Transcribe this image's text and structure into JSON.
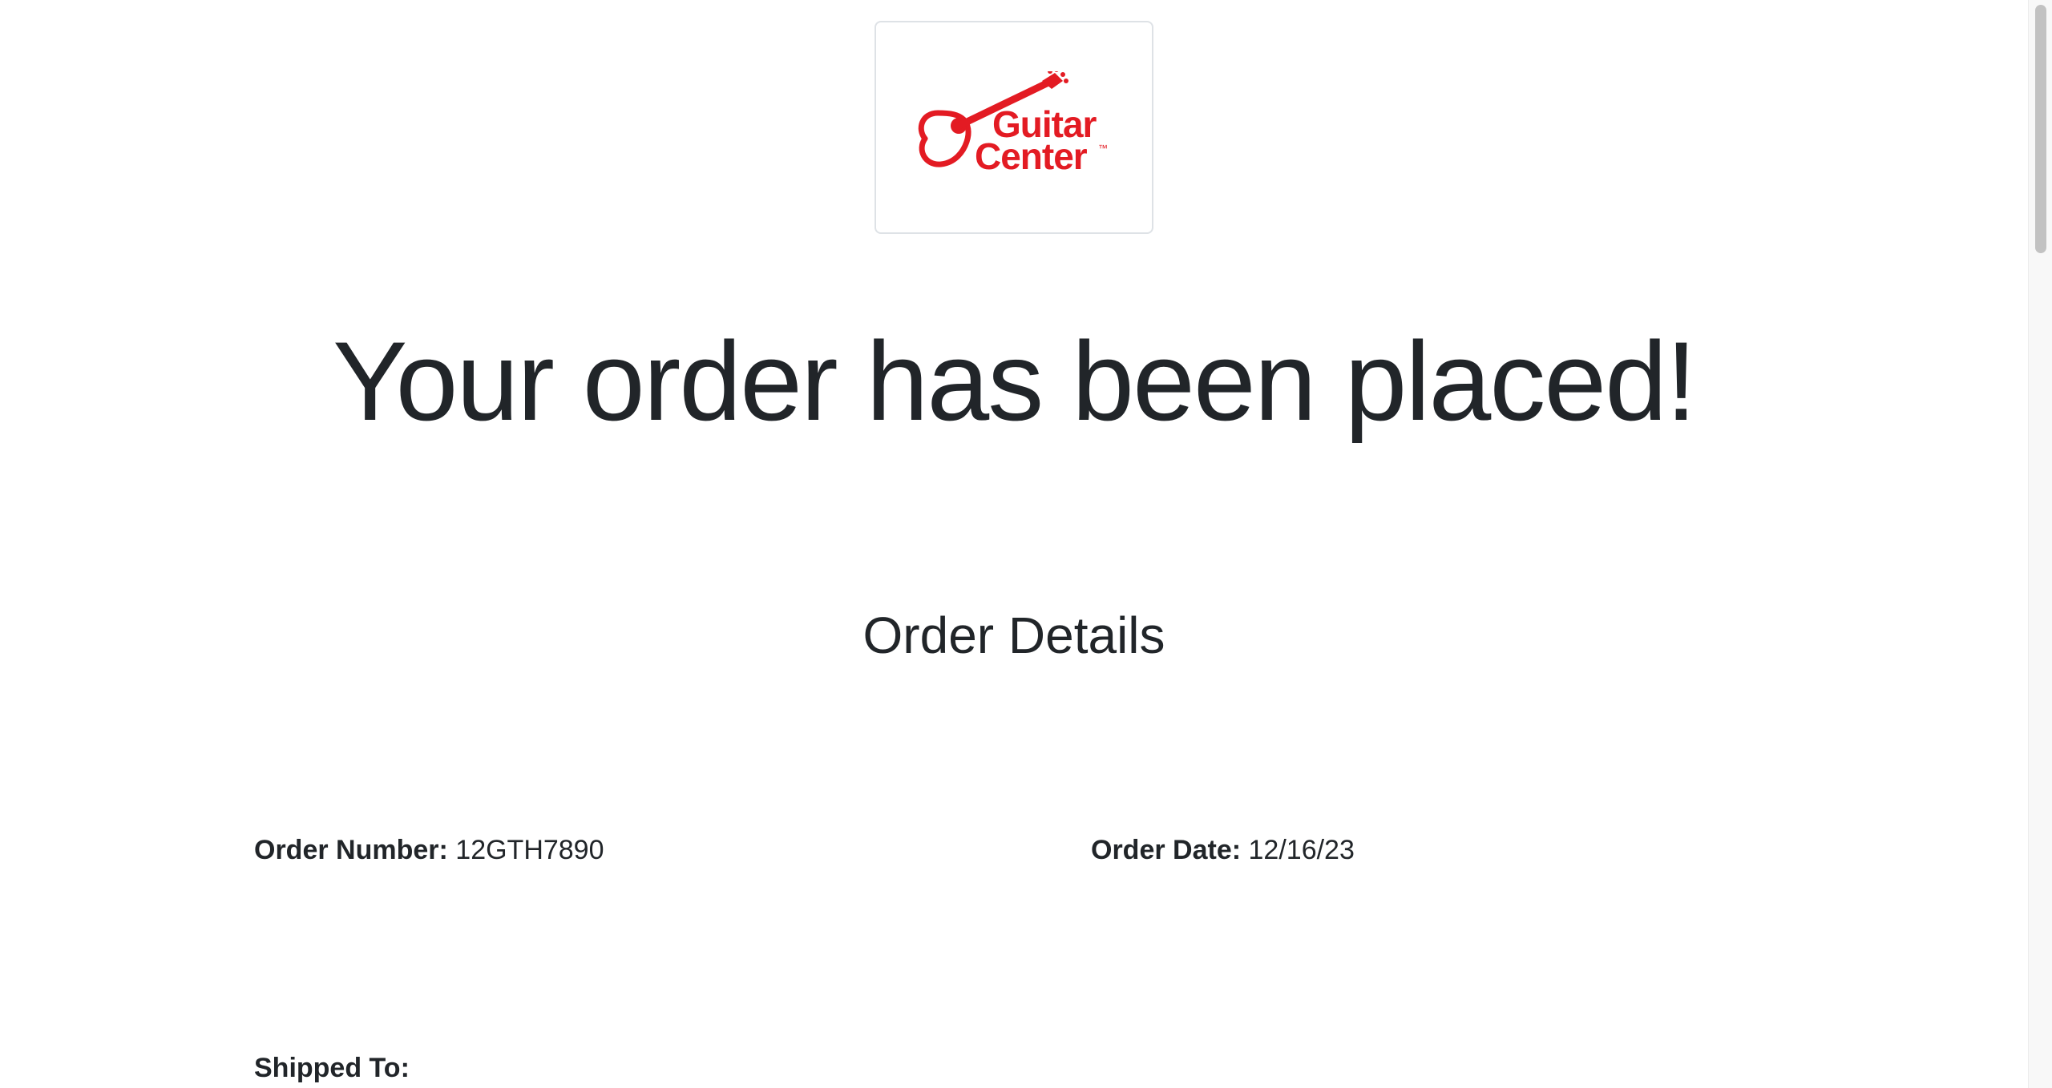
{
  "brand": {
    "logo_line1": "Guitar",
    "logo_line2": "Center",
    "logo_trademark": "™",
    "accent_color": "#e31b23"
  },
  "headline": "Your order has been placed!",
  "section_title": "Order Details",
  "order": {
    "number_label": "Order Number:",
    "number_value": "12GTH7890",
    "date_label": "Order Date:",
    "date_value": "12/16/23"
  },
  "shipping": {
    "label": "Shipped To:"
  },
  "icons": {
    "logo": "guitar-center-logo-icon"
  }
}
